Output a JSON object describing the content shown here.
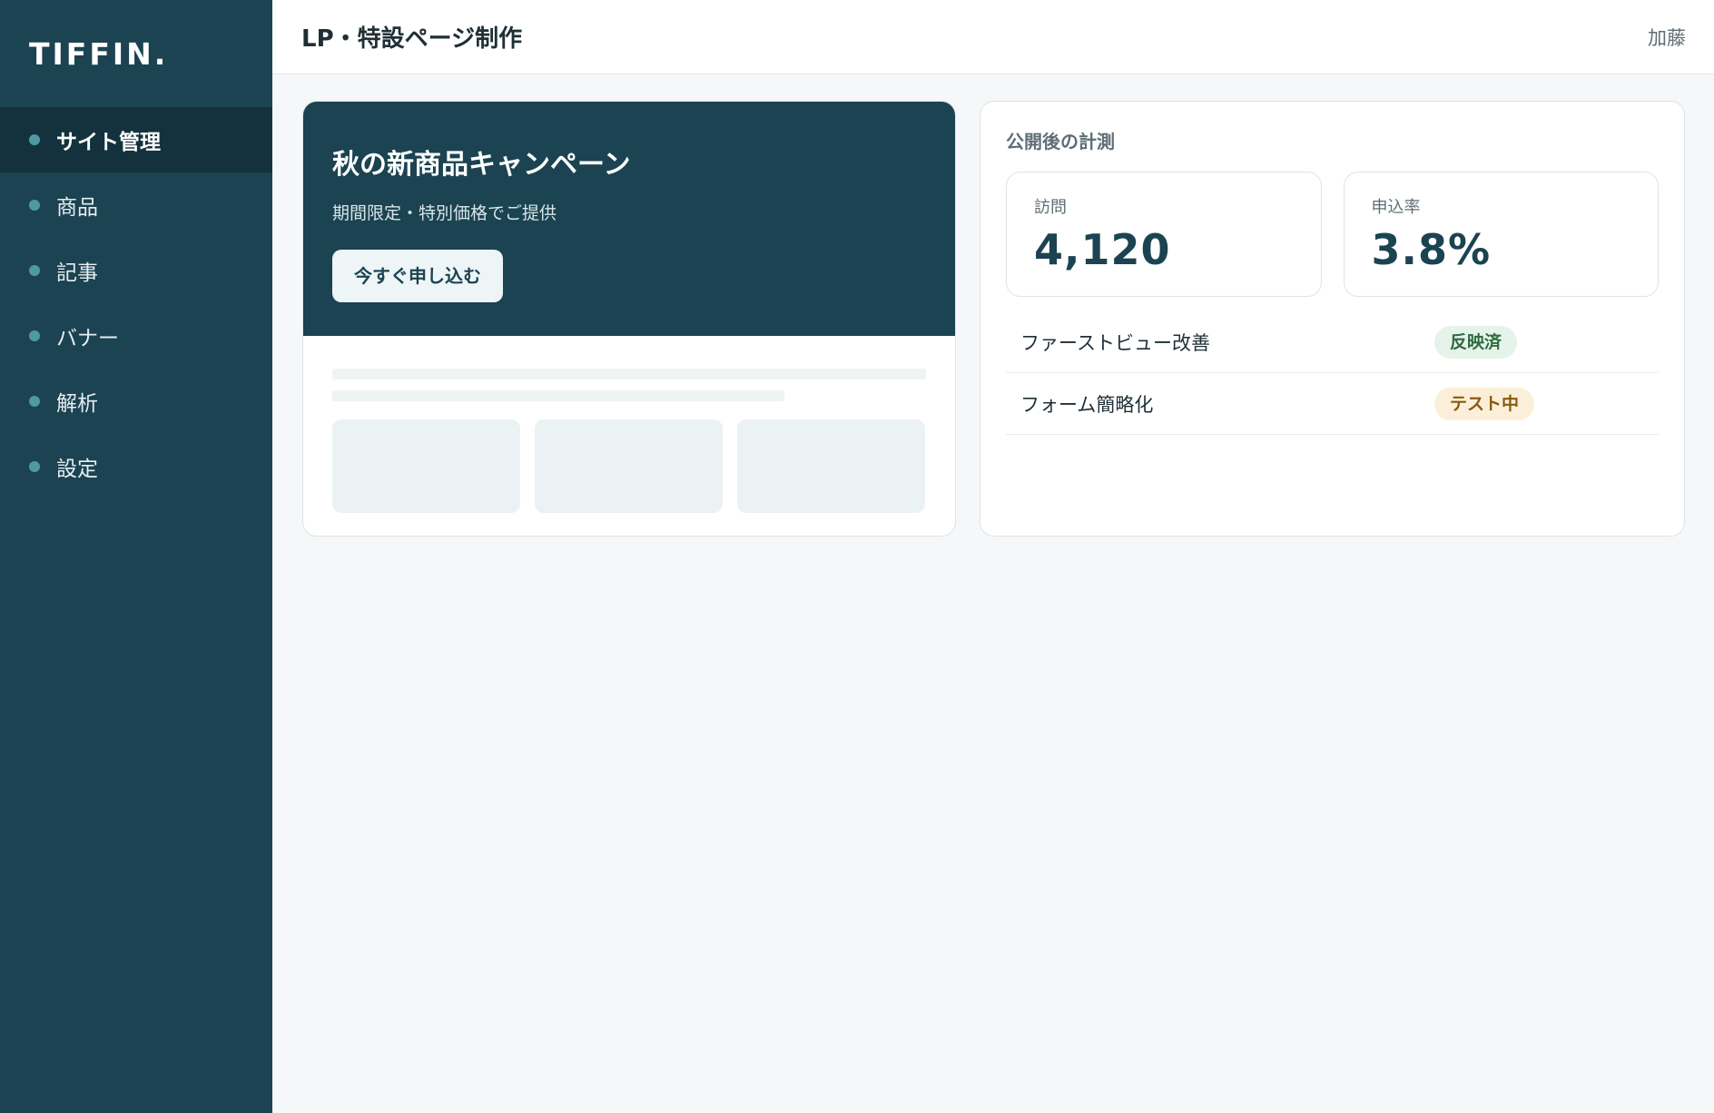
{
  "sidebar": {
    "logo": "TIFFIN.",
    "items": [
      {
        "label": "サイト管理",
        "active": true
      },
      {
        "label": "商品",
        "active": false
      },
      {
        "label": "記事",
        "active": false
      },
      {
        "label": "バナー",
        "active": false
      },
      {
        "label": "解析",
        "active": false
      },
      {
        "label": "設定",
        "active": false
      }
    ]
  },
  "header": {
    "title": "LP・特設ページ制作",
    "user": "加藤"
  },
  "preview": {
    "hero_title": "秋の新商品キャンペーン",
    "hero_subtitle": "期間限定・特別価格でご提供",
    "cta_label": "今すぐ申し込む"
  },
  "metrics": {
    "heading": "公開後の計測",
    "kpis": [
      {
        "label": "訪問",
        "value": "4,120"
      },
      {
        "label": "申込率",
        "value": "3.8%"
      }
    ],
    "tests": [
      {
        "name": "ファーストビュー改善",
        "status": "反映済",
        "badge_bg": "#e6f3ea",
        "badge_fg": "#2e6b40"
      },
      {
        "name": "フォーム簡略化",
        "status": "テスト中",
        "badge_bg": "#fcefd9",
        "badge_fg": "#8a5a10"
      }
    ]
  },
  "colors": {
    "brand": "#1b4351",
    "nav_dot": "#4f9aa0"
  }
}
